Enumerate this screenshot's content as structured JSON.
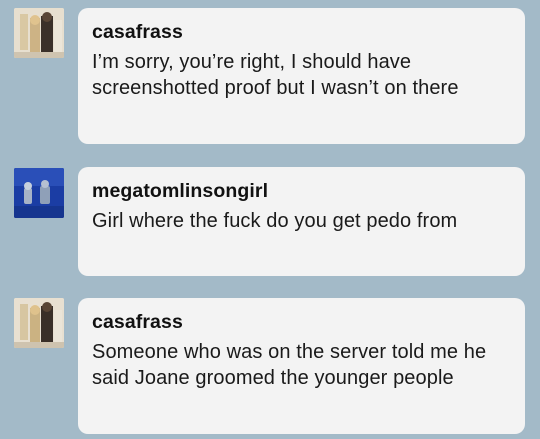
{
  "messages": [
    {
      "username": "casafrass",
      "text": "I’m sorry, you’re right, I should have screenshotted proof but I wasn’t on there"
    },
    {
      "username": "megatomlinsongirl",
      "text": "Girl where the fuck do you get pedo from"
    },
    {
      "username": "casafrass",
      "text": "Someone who was on the server told me he said Joane groomed the younger people"
    }
  ]
}
